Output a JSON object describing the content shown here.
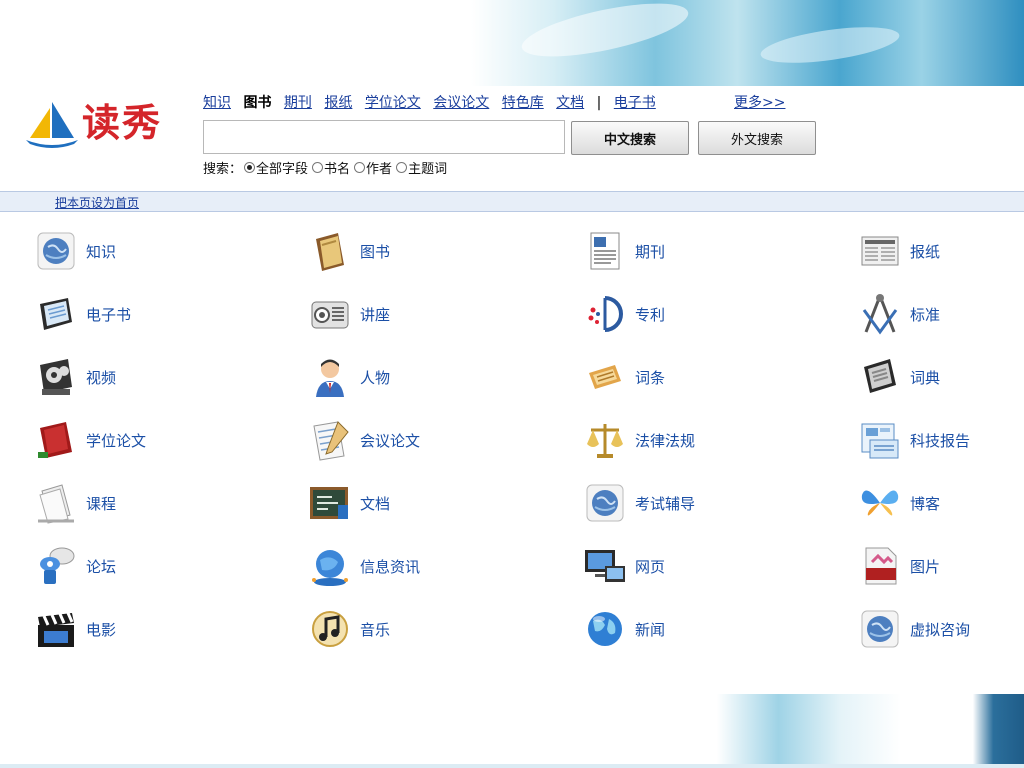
{
  "logo": {
    "text": "读秀"
  },
  "nav": {
    "items": [
      {
        "label": "知识",
        "active": false
      },
      {
        "label": "图书",
        "active": true
      },
      {
        "label": "期刊",
        "active": false
      },
      {
        "label": "报纸",
        "active": false
      },
      {
        "label": "学位论文",
        "active": false
      },
      {
        "label": "会议论文",
        "active": false
      },
      {
        "label": "特色库",
        "active": false
      },
      {
        "label": "文档",
        "active": false
      },
      {
        "label": "电子书",
        "active": false
      }
    ],
    "separator": "|",
    "more": "更多>>"
  },
  "search": {
    "value": "",
    "cn_button": "中文搜索",
    "foreign_button": "外文搜索",
    "options_label": "搜索：",
    "options": [
      {
        "label": "全部字段",
        "checked": true
      },
      {
        "label": "书名",
        "checked": false
      },
      {
        "label": "作者",
        "checked": false
      },
      {
        "label": "主题词",
        "checked": false
      }
    ]
  },
  "homebar": {
    "link": "把本页设为首页"
  },
  "categories": [
    {
      "label": "知识",
      "icon": "globe-icon"
    },
    {
      "label": "图书",
      "icon": "book-icon"
    },
    {
      "label": "期刊",
      "icon": "journal-icon"
    },
    {
      "label": "报纸",
      "icon": "newspaper-icon"
    },
    {
      "label": "电子书",
      "icon": "ebook-icon"
    },
    {
      "label": "讲座",
      "icon": "lecture-icon"
    },
    {
      "label": "专利",
      "icon": "patent-icon"
    },
    {
      "label": "标准",
      "icon": "compass-icon"
    },
    {
      "label": "视频",
      "icon": "film-reel-icon"
    },
    {
      "label": "人物",
      "icon": "person-icon"
    },
    {
      "label": "词条",
      "icon": "scroll-icon"
    },
    {
      "label": "词典",
      "icon": "dictionary-icon"
    },
    {
      "label": "学位论文",
      "icon": "thesis-book-icon"
    },
    {
      "label": "会议论文",
      "icon": "notepad-icon"
    },
    {
      "label": "法律法规",
      "icon": "scales-icon"
    },
    {
      "label": "科技报告",
      "icon": "report-icon"
    },
    {
      "label": "课程",
      "icon": "pages-icon"
    },
    {
      "label": "文档",
      "icon": "blackboard-icon"
    },
    {
      "label": "考试辅导",
      "icon": "globe-icon"
    },
    {
      "label": "博客",
      "icon": "butterfly-icon"
    },
    {
      "label": "论坛",
      "icon": "forum-icon"
    },
    {
      "label": "信息资讯",
      "icon": "network-globe-icon"
    },
    {
      "label": "网页",
      "icon": "monitor-icon"
    },
    {
      "label": "图片",
      "icon": "jpeg-icon"
    },
    {
      "label": "电影",
      "icon": "clapperboard-icon"
    },
    {
      "label": "音乐",
      "icon": "music-note-icon"
    },
    {
      "label": "新闻",
      "icon": "earth-icon"
    },
    {
      "label": "虚拟咨询",
      "icon": "globe-icon"
    }
  ],
  "colors": {
    "link": "#1a3e9c",
    "label": "#1b4fa6",
    "logo": "#d4252a",
    "homebar_bg": "#e7eef8"
  }
}
